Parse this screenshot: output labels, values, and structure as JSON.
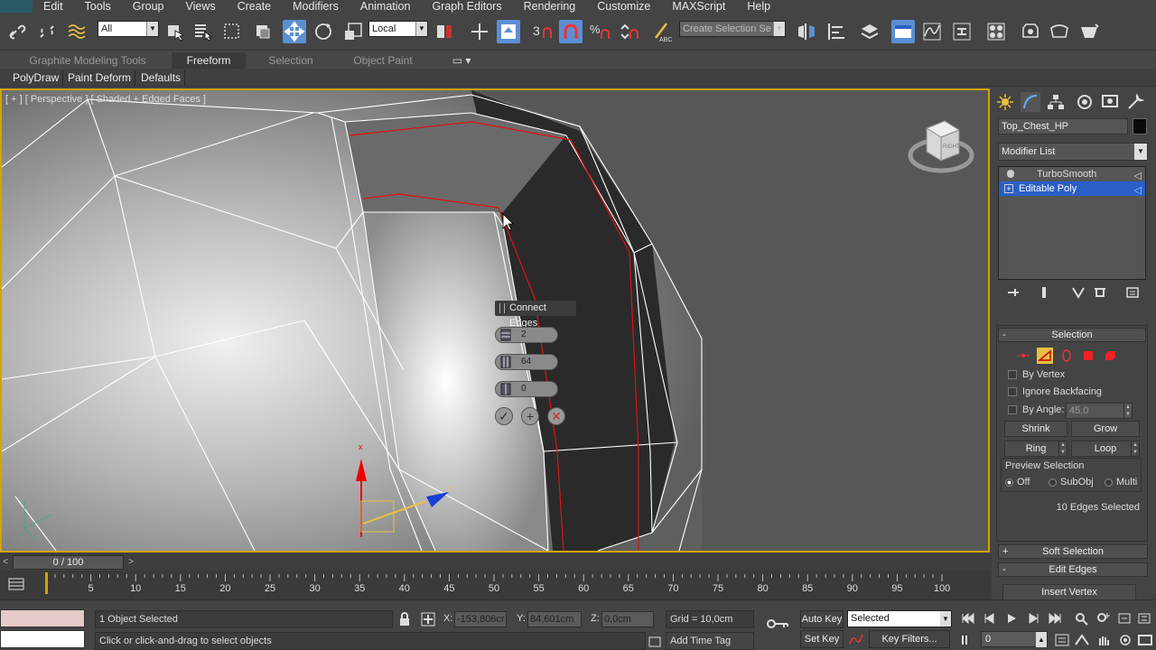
{
  "menubar": {
    "items": [
      "Edit",
      "Tools",
      "Group",
      "Views",
      "Create",
      "Modifiers",
      "Animation",
      "Graph Editors",
      "Rendering",
      "Customize",
      "MAXScript",
      "Help"
    ]
  },
  "toolbar": {
    "selection_filter": "All",
    "ref_coord": "Local",
    "named_selection_placeholder": "Create Selection Se"
  },
  "ribbon": {
    "tabs": [
      "Graphite Modeling Tools",
      "Freeform",
      "Selection",
      "Object Paint"
    ],
    "active_tab": "Freeform",
    "subtabs": [
      "PolyDraw",
      "Paint Deform",
      "Defaults"
    ]
  },
  "viewport": {
    "label": "[ + ] [ Perspective ] [ Shaded + Edged Faces ]",
    "viewcube_face": "RIGHT",
    "gizmo_axes": [
      "x",
      "z"
    ],
    "caddy": {
      "title": "Connect Edges",
      "segments": "2",
      "pinch": "64",
      "slide": "0"
    }
  },
  "command_panel": {
    "object_name": "Top_Chest_HP",
    "object_color": "#000000",
    "modifier_list": "Modifier List",
    "stack": [
      "TurboSmooth",
      "Editable Poly"
    ],
    "selected_stack_item": "Editable Poly",
    "selection_rollout": {
      "title": "Selection",
      "by_vertex": "By Vertex",
      "ignore_backfacing": "Ignore Backfacing",
      "by_angle": "By Angle:",
      "angle_value": "45,0",
      "shrink": "Shrink",
      "grow": "Grow",
      "ring": "Ring",
      "loop": "Loop",
      "preview_selection": "Preview Selection",
      "preview_options": [
        "Off",
        "SubObj",
        "Multi"
      ],
      "status": "10 Edges Selected"
    },
    "soft_selection": "Soft Selection",
    "edit_edges": "Edit Edges",
    "insert_vertex": "Insert Vertex"
  },
  "timeline": {
    "slider": "0 / 100",
    "ticks": [
      "0",
      "5",
      "10",
      "15",
      "20",
      "25",
      "30",
      "35",
      "40",
      "45",
      "50",
      "55",
      "60",
      "65",
      "70",
      "75",
      "80",
      "85",
      "90",
      "95",
      "100"
    ]
  },
  "statusbar": {
    "selection_info": "1 Object Selected",
    "prompt": "Click or click-and-drag to select objects",
    "x_label": "X:",
    "x_value": "-153,806cr",
    "y_label": "Y:",
    "y_value": "84,601cm",
    "z_label": "Z:",
    "z_value": "0,0cm",
    "grid": "Grid = 10,0cm",
    "add_time_tag": "Add Time Tag",
    "auto_key": "Auto Key",
    "set_key": "Set Key",
    "key_mode": "Selected",
    "key_filters": "Key Filters...",
    "frame": "0"
  }
}
